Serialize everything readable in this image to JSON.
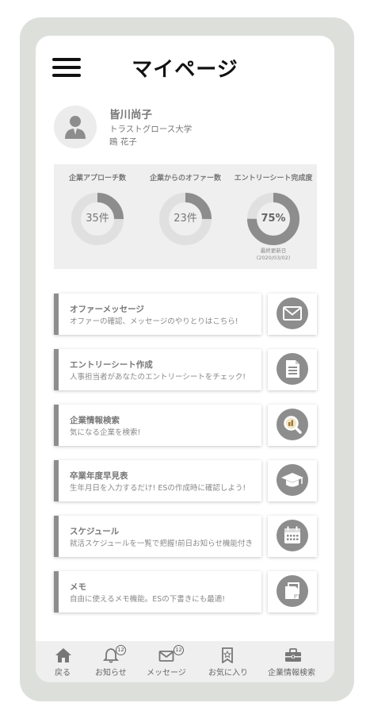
{
  "header": {
    "title": "マイページ"
  },
  "profile": {
    "name": "皆川尚子",
    "school": "トラストグロース大学",
    "sub": "鴎 花子"
  },
  "stats": [
    {
      "label": "企業アプローチ数",
      "value": "35件",
      "progress": 0.25
    },
    {
      "label": "企業からのオファー数",
      "value": "23件",
      "progress": 0.25
    },
    {
      "label": "エントリーシート完成度",
      "value": "75%",
      "progress": 0.75,
      "note_line1": "最終更新日",
      "note_line2": "(2020/03/02)"
    }
  ],
  "menu": [
    {
      "title": "オファーメッセージ",
      "desc": "オファーの確認、メッセージのやりとりはこちら!",
      "icon": "envelope-icon"
    },
    {
      "title": "エントリーシート作成",
      "desc": "人事担当者があなたのエントリーシートをチェック!",
      "icon": "document-icon"
    },
    {
      "title": "企業情報検索",
      "desc": "気になる企業を検索!",
      "icon": "search-company-icon"
    },
    {
      "title": "卒業年度早見表",
      "desc": "生年月日を入力するだけ! ESの作成時に確認しよう!",
      "icon": "graduation-cap-icon"
    },
    {
      "title": "スケジュール",
      "desc": "就活スケジュールを一覧で把握!前日お知らせ機能付き",
      "icon": "calendar-icon"
    },
    {
      "title": "メモ",
      "desc": "自由に使えるメモ機能。ESの下書きにも最適!",
      "icon": "memo-icon"
    }
  ],
  "bottom_nav": [
    {
      "label": "戻る",
      "icon": "home-icon"
    },
    {
      "label": "お知らせ",
      "icon": "bell-icon",
      "badge": "12"
    },
    {
      "label": "メッセージ",
      "icon": "mail-icon",
      "badge": "12"
    },
    {
      "label": "お気に入り",
      "icon": "bookmark-icon"
    },
    {
      "label": "企業情報検索",
      "icon": "briefcase-icon"
    }
  ],
  "colors": {
    "frame": "#dddfdb",
    "accent_gray": "#8d8d8d",
    "ring_track": "#e0e0e0",
    "panel": "#efefef"
  }
}
